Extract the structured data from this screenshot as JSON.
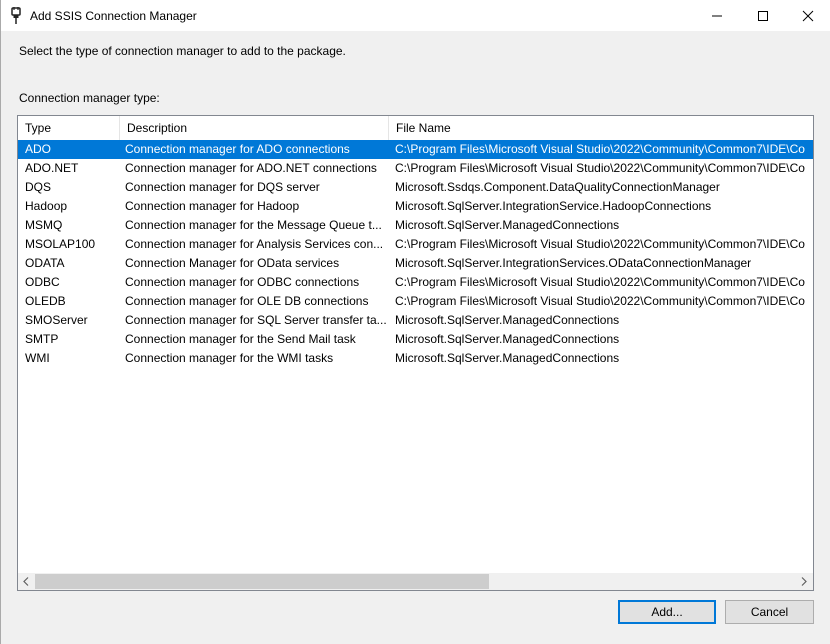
{
  "window": {
    "title": "Add SSIS Connection Manager",
    "icon": "ssis-connection-icon",
    "controls": [
      "minimize-icon",
      "maximize-icon",
      "close-icon"
    ]
  },
  "instruction": "Select the type of connection manager to add to the package.",
  "list_label": "Connection manager type:",
  "columns": {
    "type": "Type",
    "description": "Description",
    "file_name": "File Name"
  },
  "rows": [
    {
      "type": "ADO",
      "description": "Connection manager for ADO connections",
      "file": "C:\\Program Files\\Microsoft Visual Studio\\2022\\Community\\Common7\\IDE\\Co",
      "selected": true
    },
    {
      "type": "ADO.NET",
      "description": "Connection manager for ADO.NET connections",
      "file": "C:\\Program Files\\Microsoft Visual Studio\\2022\\Community\\Common7\\IDE\\Co"
    },
    {
      "type": "DQS",
      "description": "Connection manager for DQS server",
      "file": "Microsoft.Ssdqs.Component.DataQualityConnectionManager"
    },
    {
      "type": "Hadoop",
      "description": "Connection manager for Hadoop",
      "file": "Microsoft.SqlServer.IntegrationService.HadoopConnections"
    },
    {
      "type": "MSMQ",
      "description": "Connection manager for the Message Queue t...",
      "file": "Microsoft.SqlServer.ManagedConnections"
    },
    {
      "type": "MSOLAP100",
      "description": "Connection manager for Analysis Services con...",
      "file": "C:\\Program Files\\Microsoft Visual Studio\\2022\\Community\\Common7\\IDE\\Co"
    },
    {
      "type": "ODATA",
      "description": "Connection Manager for OData services",
      "file": "Microsoft.SqlServer.IntegrationServices.ODataConnectionManager"
    },
    {
      "type": "ODBC",
      "description": "Connection manager for ODBC connections",
      "file": "C:\\Program Files\\Microsoft Visual Studio\\2022\\Community\\Common7\\IDE\\Co"
    },
    {
      "type": "OLEDB",
      "description": "Connection manager for OLE DB connections",
      "file": "C:\\Program Files\\Microsoft Visual Studio\\2022\\Community\\Common7\\IDE\\Co"
    },
    {
      "type": "SMOServer",
      "description": "Connection manager for SQL Server transfer ta...",
      "file": "Microsoft.SqlServer.ManagedConnections"
    },
    {
      "type": "SMTP",
      "description": "Connection manager for the Send Mail task",
      "file": "Microsoft.SqlServer.ManagedConnections"
    },
    {
      "type": "WMI",
      "description": "Connection manager for the WMI tasks",
      "file": "Microsoft.SqlServer.ManagedConnections"
    }
  ],
  "buttons": {
    "add": "Add...",
    "cancel": "Cancel"
  },
  "colors": {
    "selection": "#0078d7",
    "default_button_border": "#0078d7"
  }
}
